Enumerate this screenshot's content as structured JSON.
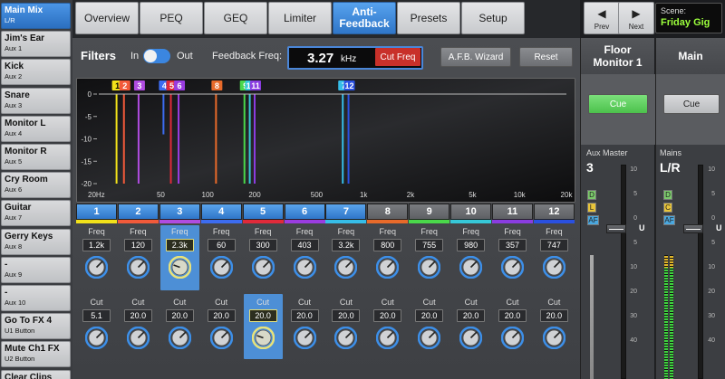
{
  "mixes": [
    {
      "name": "Main Mix",
      "sub": "L/R",
      "selected": true
    },
    {
      "name": "Jim's Ear",
      "sub": "Aux 1"
    },
    {
      "name": "Kick",
      "sub": "Aux 2"
    },
    {
      "name": "Snare",
      "sub": "Aux 3"
    },
    {
      "name": "Monitor L",
      "sub": "Aux 4"
    },
    {
      "name": "Monitor R",
      "sub": "Aux 5"
    },
    {
      "name": "Cry Room",
      "sub": "Aux 6"
    },
    {
      "name": "Guitar",
      "sub": "Aux 7"
    },
    {
      "name": "Gerry Keys",
      "sub": "Aux 8"
    },
    {
      "name": "-",
      "sub": "Aux 9"
    },
    {
      "name": "-",
      "sub": "Aux 10"
    },
    {
      "name": "Go To FX 4",
      "sub": "U1 Button"
    },
    {
      "name": "Mute Ch1 FX",
      "sub": "U2 Button"
    },
    {
      "name": "Clear Clips",
      "sub": ""
    }
  ],
  "tabs": [
    {
      "label": "Overview"
    },
    {
      "label": "PEQ"
    },
    {
      "label": "GEQ"
    },
    {
      "label": "Limiter"
    },
    {
      "label": "Anti-\nFeedback",
      "active": true
    },
    {
      "label": "Presets"
    },
    {
      "label": "Setup"
    }
  ],
  "nav": {
    "prev_label": "Prev",
    "next_label": "Next",
    "prev_icon": "chevron-left-icon",
    "next_icon": "chevron-right-icon"
  },
  "scene": {
    "label": "Scene:",
    "value": "Friday Gig"
  },
  "filters": {
    "title": "Filters",
    "in_label": "In",
    "out_label": "Out",
    "toggle_on": true,
    "feedback_label": "Feedback Freq:",
    "feedback_value": "3.27",
    "feedback_unit": "kHz",
    "cut_freq_label": "Cut Freq",
    "wizard_label": "A.F.B. Wizard",
    "reset_label": "Reset"
  },
  "graph": {
    "y_ticks": [
      "0",
      "-5",
      "-10",
      "-15",
      "-20"
    ],
    "x_ticks": [
      {
        "label": "20Hz",
        "hz": 20
      },
      {
        "label": "50",
        "hz": 50
      },
      {
        "label": "100",
        "hz": 100
      },
      {
        "label": "200",
        "hz": 200
      },
      {
        "label": "500",
        "hz": 500
      },
      {
        "label": "1k",
        "hz": 1000
      },
      {
        "label": "2k",
        "hz": 2000
      },
      {
        "label": "5k",
        "hz": 5000
      },
      {
        "label": "10k",
        "hz": 10000
      },
      {
        "label": "20k",
        "hz": 20000
      }
    ],
    "y_range": [
      0,
      -20
    ],
    "x_range": [
      20,
      20000
    ],
    "x_scale": "log"
  },
  "channels": [
    {
      "num": "1",
      "freq": "1.2k",
      "cut": "5.1",
      "active": true,
      "color": "#f2e21a",
      "hz": 26,
      "db": -20
    },
    {
      "num": "2",
      "freq": "120",
      "cut": "20.0",
      "active": true,
      "color": "#f25a3a",
      "hz": 29,
      "db": -20
    },
    {
      "num": "3",
      "freq": "2.3k",
      "cut": "20.0",
      "active": true,
      "color": "#b04ce0",
      "hz": 36,
      "db": -20,
      "freq_selected": true
    },
    {
      "num": "4",
      "freq": "60",
      "cut": "20.0",
      "active": true,
      "color": "#3c6cf0",
      "hz": 52,
      "db": -9
    },
    {
      "num": "5",
      "freq": "300",
      "cut": "20.0",
      "active": true,
      "color": "#e02a3a",
      "hz": 58,
      "db": -20,
      "cut_selected": true
    },
    {
      "num": "6",
      "freq": "403",
      "cut": "20.0",
      "active": true,
      "color": "#9a3ce0",
      "hz": 65,
      "db": -20
    },
    {
      "num": "7",
      "freq": "3.2k",
      "cut": "20.0",
      "active": true,
      "color": "#36bde8",
      "hz": 735,
      "db": -20
    },
    {
      "num": "8",
      "freq": "800",
      "cut": "20.0",
      "active": false,
      "color": "#e86a2a",
      "hz": 113,
      "db": -20
    },
    {
      "num": "9",
      "freq": "755",
      "cut": "20.0",
      "active": false,
      "color": "#4ad84a",
      "hz": 172,
      "db": -20
    },
    {
      "num": "10",
      "freq": "980",
      "cut": "20.0",
      "active": false,
      "color": "#36c8d8",
      "hz": 186,
      "db": -20
    },
    {
      "num": "11",
      "freq": "357",
      "cut": "20.0",
      "active": false,
      "color": "#8a3ce0",
      "hz": 200,
      "db": -20
    },
    {
      "num": "12",
      "freq": "747",
      "cut": "20.0",
      "active": false,
      "color": "#2a50e0",
      "hz": 800,
      "db": -20
    }
  ],
  "freq_label": "Freq",
  "cut_label": "Cut",
  "monitor": {
    "name": "Floor\nMonitor 1",
    "cue_label": "Cue",
    "sub_label": "Aux Master",
    "number": "3",
    "badges": [
      "D",
      "L",
      "AF"
    ],
    "scale": [
      "10",
      "5",
      "0",
      "5",
      "10",
      "20",
      "30",
      "40"
    ],
    "unity": "U"
  },
  "main": {
    "name": "Main",
    "cue_label": "Cue",
    "sub_label": "Mains",
    "number": "L/R",
    "badges": [
      "D",
      "C",
      "AF"
    ],
    "scale": [
      "10",
      "5",
      "0",
      "5",
      "10",
      "20",
      "30",
      "40"
    ],
    "unity": "U"
  }
}
